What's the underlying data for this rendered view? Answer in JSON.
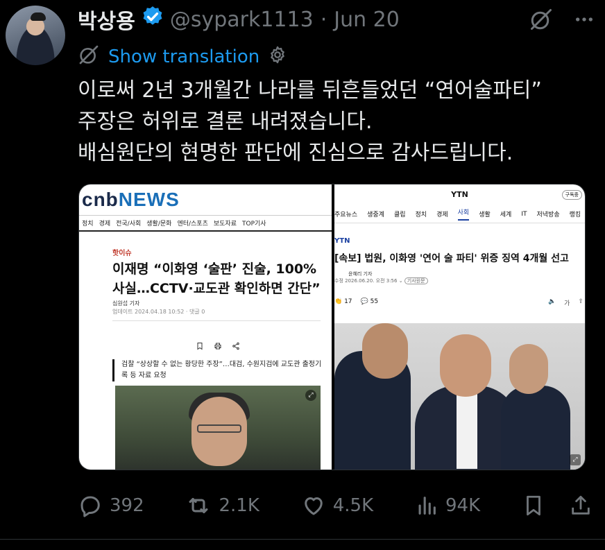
{
  "tweet": {
    "author_name": "박상용",
    "handle": "@sypark1113",
    "separator": "·",
    "date": "Jun 20",
    "show_translation": "Show translation",
    "text_lines": [
      "이로써 2년 3개월간 나라를 뒤흔들었던 “연어술파티”",
      "주장은 허위로 결론 내려졌습니다.",
      "배심원단의 현명한 판단에 진심으로 감사드립니다."
    ]
  },
  "media": {
    "left": {
      "logo_part1": "cnb",
      "logo_part2": "NEWS",
      "nav": [
        "정치",
        "경제",
        "전국/사회",
        "생활/문화",
        "엔터/스포츠",
        "보도자료",
        "TOP기사"
      ],
      "tag": "핫이슈",
      "title": "이재명 “이화영 ‘술판’ 진술, 100% 사실…CCTV·교도관 확인하면 간단”",
      "reporter": "심원섭 기자",
      "updated": "업데이트 2024.04.18 10:52 · 댓글 0",
      "summary": "검찰 “상상할 수 없는 황당한 주장”…대검, 수원지검에 교도관 출정기록 등 자료 요청"
    },
    "right": {
      "top": "YTN",
      "subscribe": "구독중",
      "nav": [
        "주요뉴스",
        "생중계",
        "클립",
        "정치",
        "경제",
        "사회",
        "생활",
        "세계",
        "IT",
        "저녁방송",
        "랭킹"
      ],
      "active_nav": "사회",
      "brand": "YTN",
      "title": "[속보] 법원, 이화영 '연어 술 파티' 위증 징역 4개월 선고",
      "reporter": "윤혜리 기자",
      "date": "수정 2026.06.20. 오전 3:56",
      "original": "기사원문",
      "likes": "17",
      "comments": "55",
      "share_label": "가"
    }
  },
  "actions": {
    "replies": "392",
    "reposts": "2.1K",
    "likes": "4.5K",
    "views": "94K"
  },
  "colors": {
    "background": "#000000",
    "text": "#e7e9ea",
    "muted": "#71767b",
    "link": "#1d9bf0",
    "verified": "#1d9bf0"
  }
}
